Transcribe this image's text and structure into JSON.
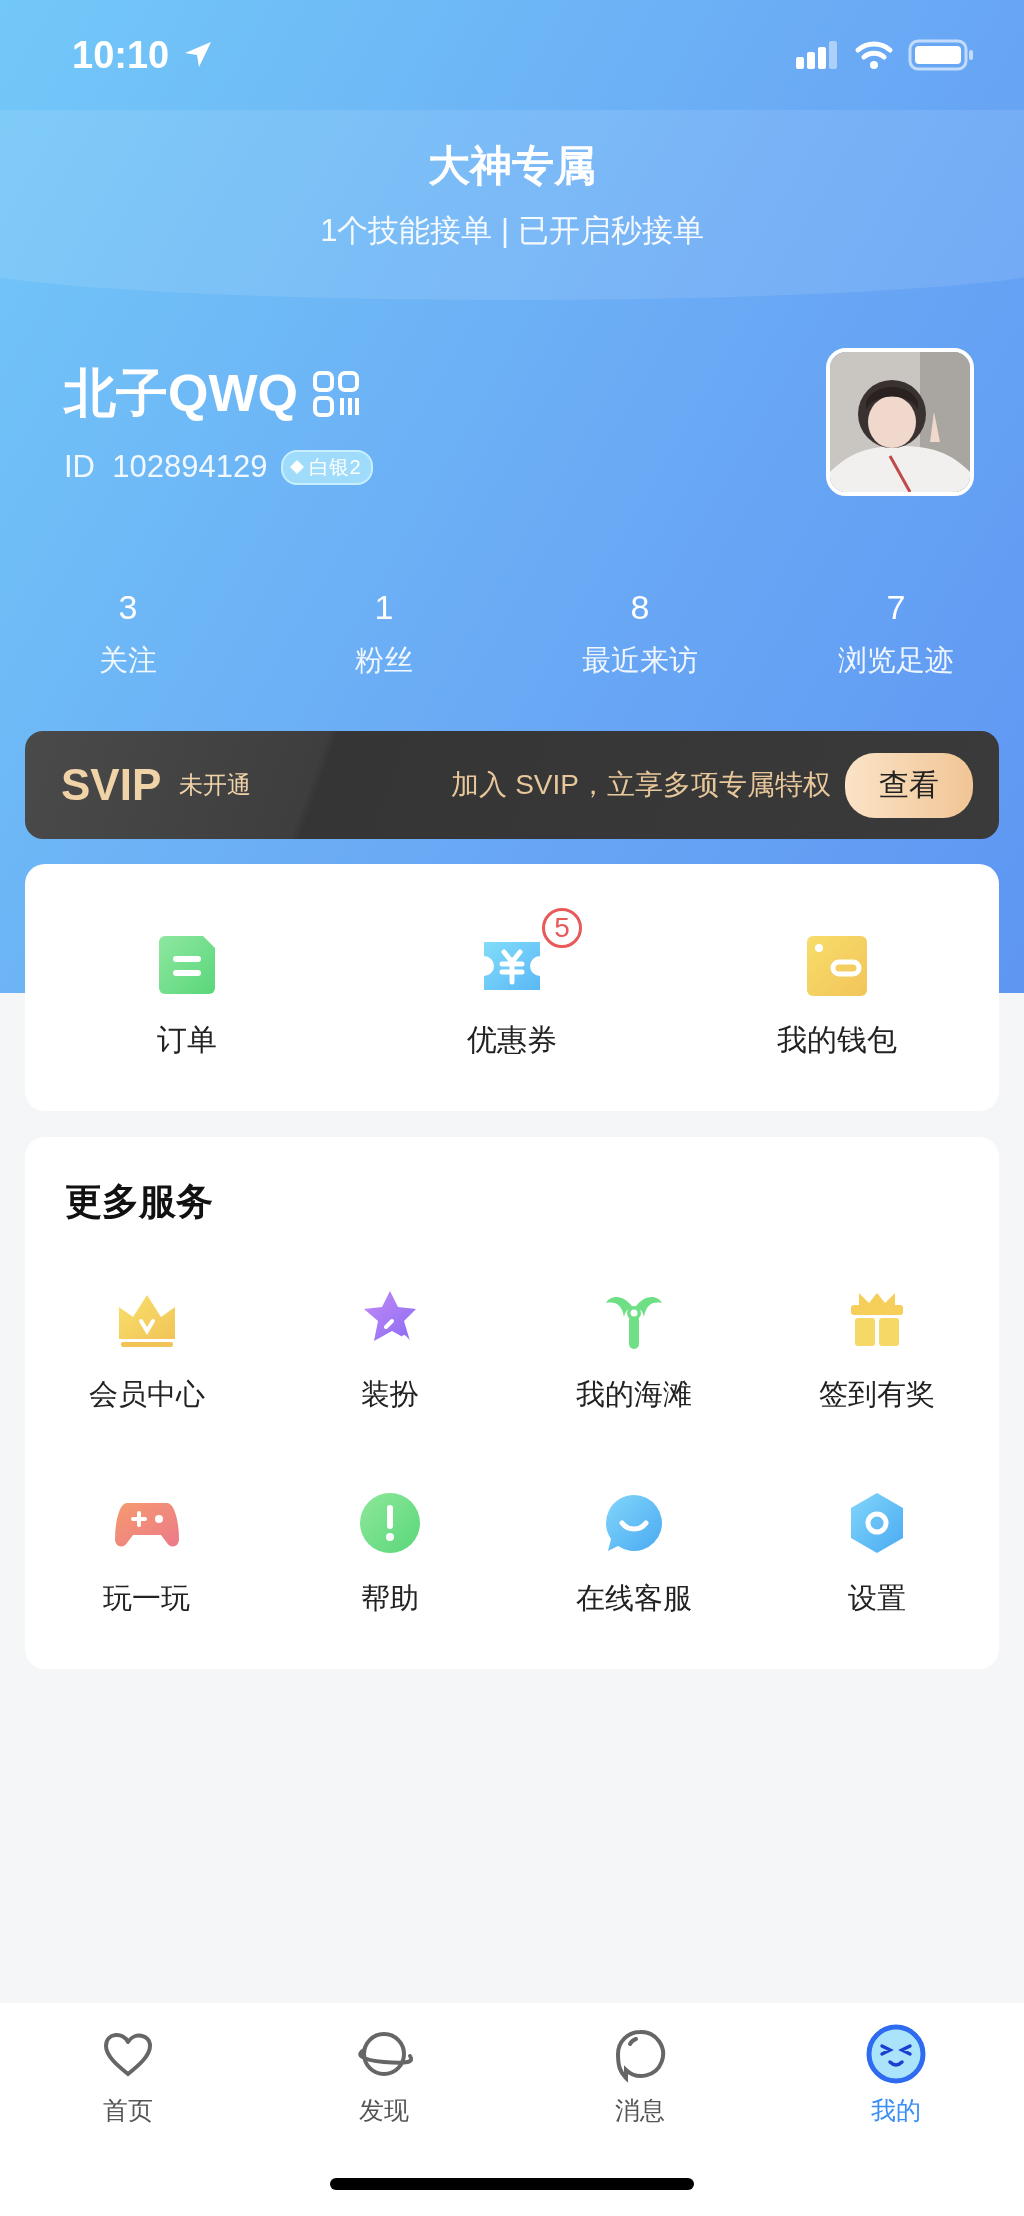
{
  "status_bar": {
    "time": "10:10"
  },
  "header": {
    "title": "大神专属",
    "subtitle": "1个技能接单 | 已开启秒接单"
  },
  "profile": {
    "name": "北子QWQ",
    "id_label": "ID",
    "id": "102894129",
    "level_badge": "白银2"
  },
  "stats": [
    {
      "value": "3",
      "label": "关注"
    },
    {
      "value": "1",
      "label": "粉丝"
    },
    {
      "value": "8",
      "label": "最近来访"
    },
    {
      "value": "7",
      "label": "浏览足迹"
    }
  ],
  "svip": {
    "title": "SVIP",
    "status": "未开通",
    "promo": "加入 SVIP，立享多项专属特权",
    "button": "查看"
  },
  "quick_actions": [
    {
      "kind": "order",
      "label": "订单"
    },
    {
      "kind": "coupon",
      "label": "优惠券",
      "badge": "5"
    },
    {
      "kind": "wallet",
      "label": "我的钱包"
    }
  ],
  "services": {
    "title": "更多服务",
    "items": [
      {
        "kind": "crown",
        "label": "会员中心"
      },
      {
        "kind": "star",
        "label": "装扮"
      },
      {
        "kind": "palm",
        "label": "我的海滩"
      },
      {
        "kind": "gift",
        "label": "签到有奖"
      },
      {
        "kind": "gamepad",
        "label": "玩一玩"
      },
      {
        "kind": "help",
        "label": "帮助"
      },
      {
        "kind": "chat",
        "label": "在线客服"
      },
      {
        "kind": "settings",
        "label": "设置"
      }
    ]
  },
  "tab_bar": [
    {
      "kind": "heart",
      "label": "首页",
      "selected": false
    },
    {
      "kind": "planet",
      "label": "发现",
      "selected": false
    },
    {
      "kind": "bubble",
      "label": "消息",
      "selected": false
    },
    {
      "kind": "face",
      "label": "我的",
      "selected": true
    }
  ]
}
